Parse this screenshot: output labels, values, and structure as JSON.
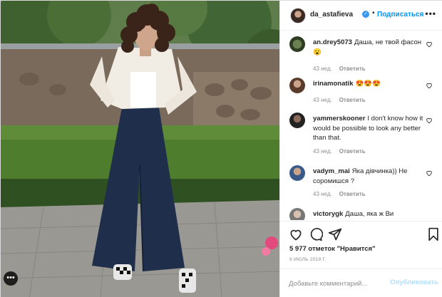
{
  "post": {
    "author": {
      "username": "da_astafieva",
      "follow_label": "Подписаться",
      "separator": "•",
      "more_label": "•••"
    },
    "comments": [
      {
        "username": "an.drey5073",
        "text": "Даша, не твой фасон 😮",
        "age": "43 нед.",
        "reply_label": "Ответить"
      },
      {
        "username": "irinamonatik",
        "text": "😍😍😍",
        "age": "43 нед.",
        "reply_label": "Ответить"
      },
      {
        "username": "yammerskooner",
        "text": "I don't know how it would be possible to look any better than that.",
        "age": "43 нед.",
        "reply_label": "Ответить"
      },
      {
        "username": "vadym_mai",
        "text": "Яка дівчинка)) Не соромишся ?",
        "age": "43 нед.",
        "reply_label": "Ответить"
      },
      {
        "username": "victorygk",
        "text": "Даша, яка ж Ви",
        "age": "",
        "reply_label": ""
      }
    ],
    "likes_text": "5 977 отметок \"Нравится\"",
    "date_text": "9 ИЮЛЬ 2019 Г.",
    "add_comment": {
      "placeholder": "Добавьте комментарий...",
      "post_label": "Опубликовать"
    },
    "photo_options_label": "•••"
  },
  "colors": {
    "link_blue": "#0095f6",
    "post_button_disabled": "#b2dffc",
    "meta_gray": "#8e8e8e",
    "verified_blue": "#3897f0"
  },
  "icons": [
    "heart-icon",
    "comment-icon",
    "share-icon",
    "bookmark-icon",
    "verified-icon",
    "more-options-icon"
  ]
}
